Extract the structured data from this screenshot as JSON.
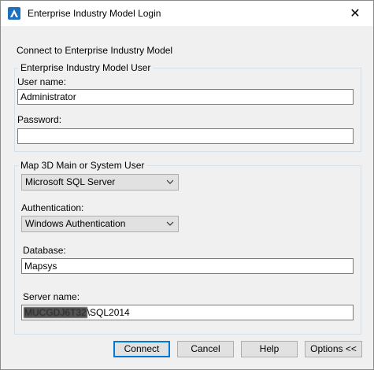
{
  "window": {
    "title": "Enterprise Industry Model Login",
    "close_glyph": "✕"
  },
  "main": {
    "connect_label": "Connect to Enterprise Industry Model"
  },
  "eim_user": {
    "legend": "Enterprise Industry Model User",
    "username_label": "User name:",
    "username_value": "Administrator",
    "password_label": "Password:",
    "password_value": ""
  },
  "map_user": {
    "legend": "Map 3D Main or System User",
    "provider_value": "Microsoft SQL Server",
    "auth_label": "Authentication:",
    "auth_value": "Windows Authentication",
    "database_label": "Database:",
    "database_value": "Mapsys",
    "server_label": "Server name:",
    "server_value_redacted": "MUCGDJ6T32",
    "server_value_suffix": "\\SQL2014"
  },
  "buttons": {
    "connect": "Connect",
    "cancel": "Cancel",
    "help": "Help",
    "options": "Options <<"
  },
  "icons": {
    "app_icon": "autodesk-a-icon",
    "close_icon": "close-icon",
    "dropdown_icon": "chevron-down-icon"
  },
  "colors": {
    "accent": "#0078d7",
    "app_icon_bg": "#1f6fbf"
  }
}
